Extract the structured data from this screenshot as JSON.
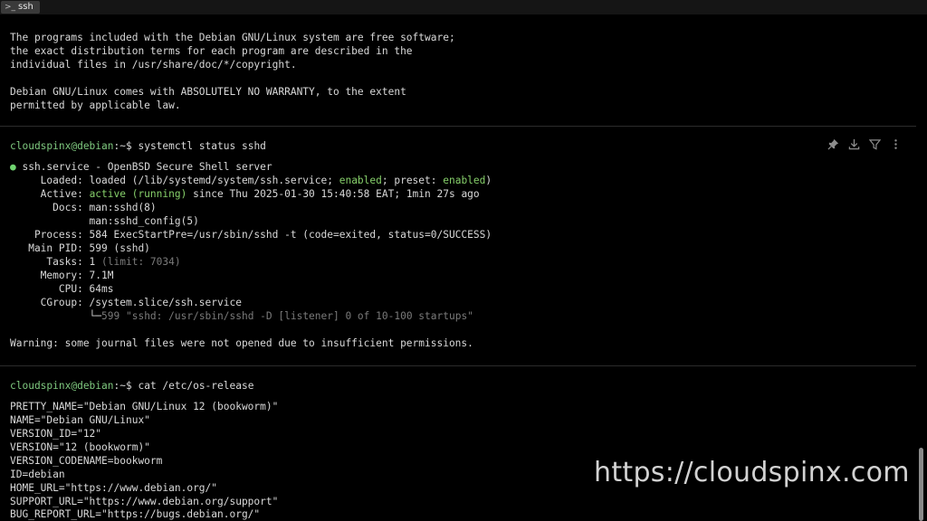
{
  "tab": {
    "label": "ssh",
    "icon": "terminal-icon"
  },
  "motd": [
    "The programs included with the Debian GNU/Linux system are free software;",
    "the exact distribution terms for each program are described in the",
    "individual files in /usr/share/doc/*/copyright.",
    "Debian GNU/Linux comes with ABSOLUTELY NO WARRANTY, to the extent",
    "permitted by applicable law."
  ],
  "prompt": "cloudspinx@debian",
  "prompt_path": ":~$ ",
  "cmd1": {
    "command": "systemctl status sshd",
    "bullet": "●",
    "service_line": " ssh.service - OpenBSD Secure Shell server",
    "loaded": {
      "key": "     Loaded: ",
      "pre": "loaded (/lib/systemd/system/ssh.service; ",
      "enabled1": "enabled",
      "mid": "; preset: ",
      "enabled2": "enabled",
      "post": ")"
    },
    "active": {
      "key": "     Active: ",
      "state": "active (running)",
      "rest": " since Thu 2025-01-30 15:40:58 EAT; 1min 27s ago"
    },
    "docs1": "       Docs: man:sshd(8)",
    "docs2": "             man:sshd_config(5)",
    "process": "    Process: 584 ExecStartPre=/usr/sbin/sshd -t (code=exited, status=0/SUCCESS)",
    "mainpid": "   Main PID: 599 (sshd)",
    "tasks": {
      "key": "      Tasks: 1 ",
      "limit": "(limit: 7034)"
    },
    "memory": "     Memory: 7.1M",
    "cpu": "        CPU: 64ms",
    "cgroup": "     CGroup: /system.slice/ssh.service",
    "cgroup_tree": {
      "branch": "             └─",
      "child": "599 \"sshd: /usr/sbin/sshd -D [listener] 0 of 10-100 startups\""
    },
    "warning": "Warning: some journal files were not opened due to insufficient permissions."
  },
  "cmd2": {
    "command": "cat /etc/os-release",
    "output": [
      "PRETTY_NAME=\"Debian GNU/Linux 12 (bookworm)\"",
      "NAME=\"Debian GNU/Linux\"",
      "VERSION_ID=\"12\"",
      "VERSION=\"12 (bookworm)\"",
      "VERSION_CODENAME=bookworm",
      "ID=debian",
      "HOME_URL=\"https://www.debian.org/\"",
      "SUPPORT_URL=\"https://www.debian.org/support\"",
      "BUG_REPORT_URL=\"https://bugs.debian.org/\""
    ]
  },
  "block_actions": [
    "pin-icon",
    "download-icon",
    "filter-icon",
    "more-icon"
  ],
  "watermark": "https://cloudspinx.com",
  "colors": {
    "prompt": "#7fc97f",
    "enabled": "#86cf6a",
    "dim": "#7a7a7a",
    "background": "#000000"
  }
}
